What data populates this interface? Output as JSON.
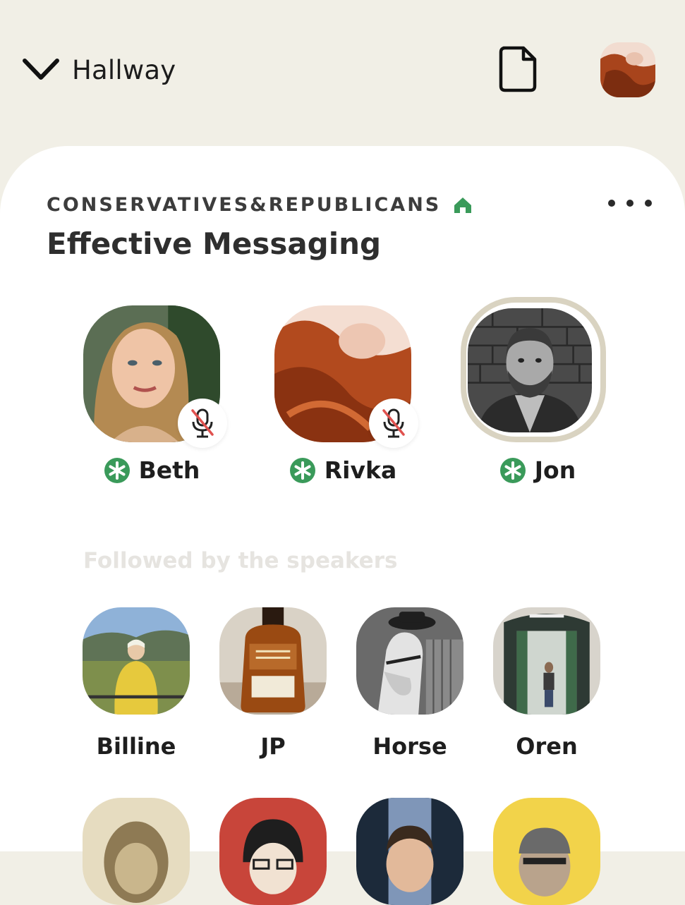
{
  "header": {
    "back_label": "Hallway",
    "icons": {
      "back": "chevron-down-icon",
      "document": "document-icon"
    }
  },
  "room": {
    "club_name": "CONSERVATIVES&REPUBLICANS",
    "club_icon": "house-icon",
    "title": "Effective Messaging",
    "more_icon": "more-dots-icon"
  },
  "speakers": [
    {
      "name": "Beth",
      "muted": true,
      "moderator": true
    },
    {
      "name": "Rivka",
      "muted": true,
      "moderator": true
    },
    {
      "name": "Jon",
      "muted": false,
      "moderator": true,
      "speaking": true
    }
  ],
  "followed_section": {
    "label": "Followed by the speakers"
  },
  "listeners": [
    {
      "name": "Billine"
    },
    {
      "name": "JP"
    },
    {
      "name": "Horse"
    },
    {
      "name": "Oren"
    }
  ],
  "colors": {
    "background": "#f1efe6",
    "card": "#ffffff",
    "accent_green": "#3a9a5a",
    "mute_red": "#e0524f",
    "speaking_ring": "#d9d3c1"
  }
}
